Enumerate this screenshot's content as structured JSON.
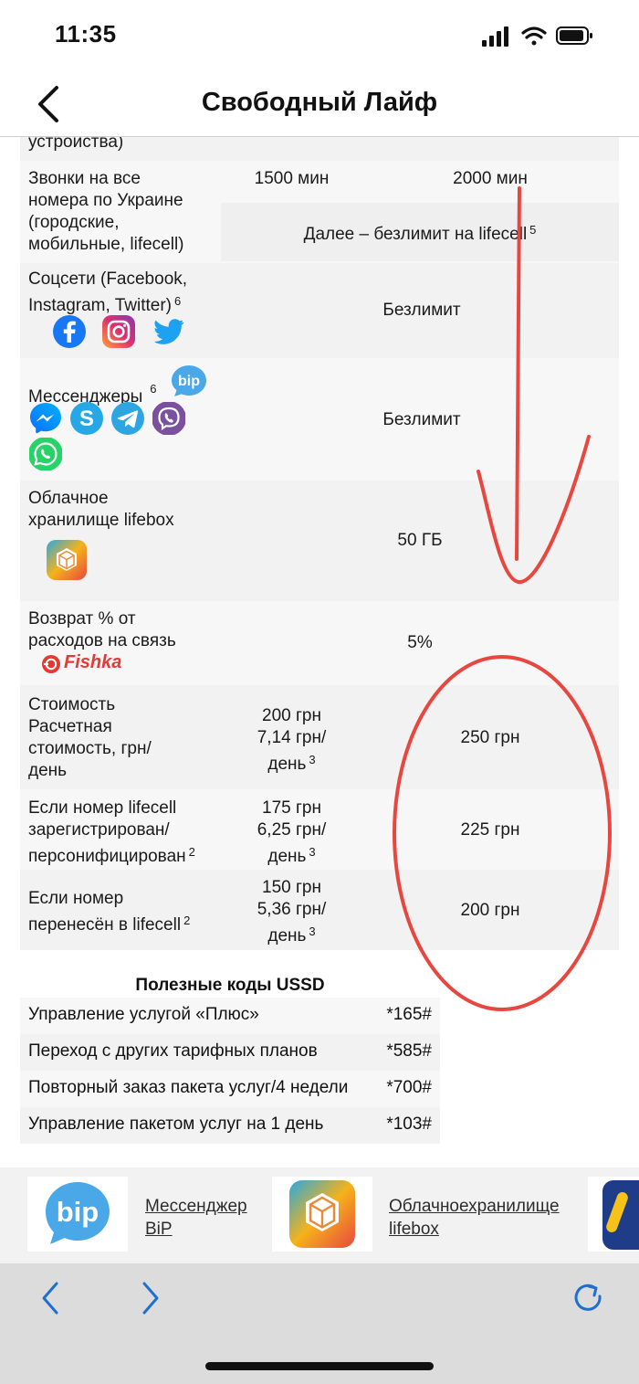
{
  "status": {
    "time": "11:35"
  },
  "nav": {
    "title": "Свободный Лайф"
  },
  "table": {
    "partial_top": "устройства)",
    "calls": {
      "label": "Звонки на все номера по Украине (городские, мобильные, lifecell)",
      "lines": [
        "Звонки на все",
        "номера по Украине",
        "(городские,",
        "мобильные, lifecell)"
      ],
      "col1": "1500 мин",
      "col2": "2000 мин",
      "after": "Далее – безлимит на lifecell",
      "after_sup": "5"
    },
    "social": {
      "lines": [
        "Соцсети (Facebook,",
        "Instagram, Twitter)"
      ],
      "sup": "6",
      "value": "Безлимит",
      "icons": [
        "facebook-icon",
        "instagram-icon",
        "twitter-icon"
      ]
    },
    "messengers": {
      "label": "Мессенджеры",
      "sup": "6",
      "value": "Безлимит",
      "icons": [
        "bip-icon",
        "messenger-icon",
        "skype-icon",
        "telegram-icon",
        "viber-icon",
        "whatsapp-icon"
      ]
    },
    "cloud": {
      "lines": [
        "Облачное",
        "хранилище lifebox"
      ],
      "value": "50 ГБ"
    },
    "cashback": {
      "lines": [
        "Возврат % от",
        "расходов на связь"
      ],
      "logo": "Fishka",
      "value": "5%"
    },
    "price": {
      "lines": [
        "Стоимость",
        "Расчетная",
        "стоимость, грн/",
        "день"
      ],
      "col1_lines": [
        "200 грн",
        "7,14 грн/",
        "день"
      ],
      "col1_sup": "3",
      "col2": "250 грн"
    },
    "registered": {
      "lines": [
        "Если номер lifecell",
        "зарегистрирован/",
        "персонифицирован"
      ],
      "sup": "2",
      "col1_lines": [
        "175 грн",
        "6,25 грн/",
        "день"
      ],
      "col1_sup": "3",
      "col2": "225 грн"
    },
    "ported": {
      "lines": [
        "Если номер",
        "перенесён в lifecell"
      ],
      "sup": "2",
      "col1_lines": [
        "150 грн",
        "5,36 грн/",
        "день"
      ],
      "col1_sup": "3",
      "col2": "200 грн"
    }
  },
  "ussd": {
    "title": "Полезные коды USSD",
    "rows": [
      {
        "label": "Управление услугой «Плюс»",
        "code": "*165#"
      },
      {
        "label": "Переход с других тарифных планов",
        "code": "*585#"
      },
      {
        "label": "Повторный заказ пакета услуг/4 недели",
        "code": "*700#"
      },
      {
        "label": "Управление пакетом услуг на 1 день",
        "code": "*103#"
      }
    ]
  },
  "promo": {
    "items": [
      {
        "icon": "bip-logo",
        "lines": [
          "Мессенджер",
          "BiP"
        ]
      },
      {
        "icon": "lifebox-logo",
        "lines": [
          "Облачноехранилище",
          "lifebox"
        ]
      }
    ]
  },
  "toolbar": {
    "back": "chevron-left-icon",
    "forward": "chevron-right-icon",
    "reload": "reload-icon"
  },
  "colors": {
    "annotation": "#e8473f",
    "link_blue": "#1f6fd1",
    "bip": "#4aa8e8",
    "fishka": "#e53935"
  }
}
